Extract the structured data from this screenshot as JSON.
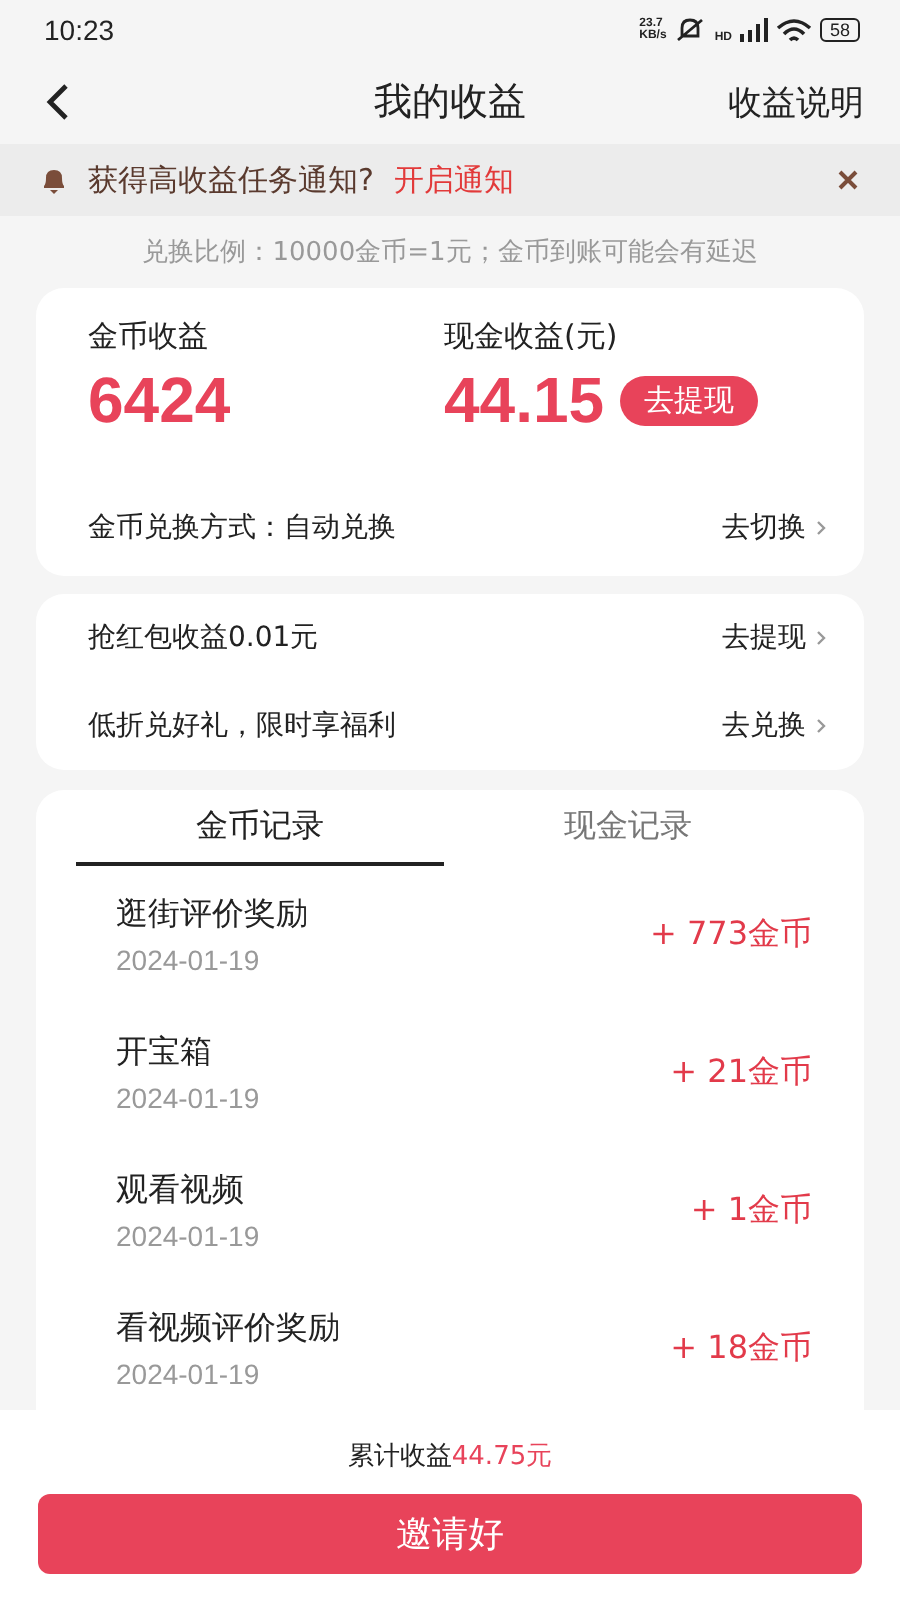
{
  "status_bar": {
    "time": "10:23",
    "speed_value": "23.7",
    "speed_unit": "KB/s",
    "network_label": "HD",
    "battery": "58"
  },
  "header": {
    "title": "我的收益",
    "action": "收益说明"
  },
  "notice": {
    "text": "获得高收益任务通知?",
    "link": "开启通知"
  },
  "ratio_note": "兑换比例：10000金币=1元；金币到账可能会有延迟",
  "earnings": {
    "coin_label": "金币收益",
    "coin_value": "6424",
    "cash_label": "现金收益(元)",
    "cash_value": "44.15",
    "withdraw_button": "去提现",
    "exchange_mode": "金币兑换方式：自动兑换",
    "exchange_action": "去切换"
  },
  "offers": [
    {
      "text": "抢红包收益0.01元",
      "action": "去提现"
    },
    {
      "text": "低折兑好礼，限时享福利",
      "action": "去兑换"
    }
  ],
  "tabs": [
    {
      "label": "金币记录",
      "selected": true
    },
    {
      "label": "现金记录",
      "selected": false
    }
  ],
  "records": [
    {
      "title": "逛街评价奖励",
      "date": "2024-01-19",
      "amount": "+ 773金币"
    },
    {
      "title": "开宝箱",
      "date": "2024-01-19",
      "amount": "+ 21金币"
    },
    {
      "title": "观看视频",
      "date": "2024-01-19",
      "amount": "+ 1金币"
    },
    {
      "title": "看视频评价奖励",
      "date": "2024-01-19",
      "amount": "+ 18金币"
    }
  ],
  "footer": {
    "total_label": "累计收益",
    "total_value": "44.75元",
    "invite_button": "邀请好"
  }
}
